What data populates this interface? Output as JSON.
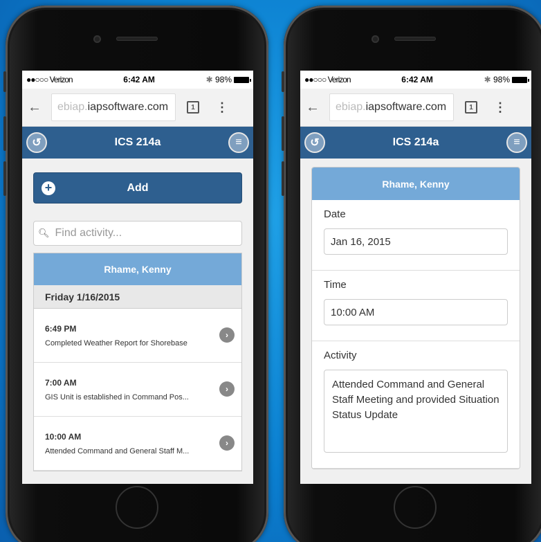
{
  "status": {
    "carrier": "●●○○○ Verizon",
    "time": "6:42 AM",
    "battery": "98%"
  },
  "browser": {
    "url_prefix": "ebiap.",
    "url_main": "iapsoftware.com",
    "tab_count": "1"
  },
  "appbar": {
    "title": "ICS 214a"
  },
  "list_screen": {
    "add_label": "Add",
    "search_placeholder": "Find activity...",
    "person": "Rhame, Kenny",
    "day": "Friday 1/16/2015",
    "items": [
      {
        "time": "6:49 PM",
        "desc": "Completed Weather Report for Shorebase"
      },
      {
        "time": "7:00 AM",
        "desc": "GIS Unit is established in Command Pos..."
      },
      {
        "time": "10:00 AM",
        "desc": "Attended Command and General Staff M..."
      }
    ]
  },
  "detail_screen": {
    "person": "Rhame, Kenny",
    "date_label": "Date",
    "date_value": "Jan 16, 2015",
    "time_label": "Time",
    "time_value": "10:00 AM",
    "activity_label": "Activity",
    "activity_value": "Attended Command and General Staff Meeting and provided Situation Status Update"
  },
  "colors": {
    "appbar": "#2e5f8f",
    "header": "#74a9d8",
    "background": "#0b7fd0"
  }
}
